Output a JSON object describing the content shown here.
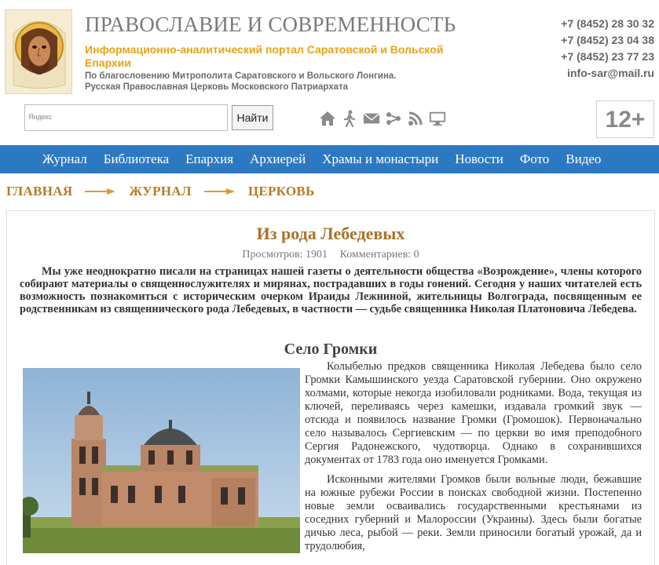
{
  "header": {
    "title": "ПРАВОСЛАВИЕ И СОВРЕМЕННОСТЬ",
    "subtitle": "Информационно-аналитический портал Саратовской и Вольской Епархии",
    "blessing_line1": "По благословению Митрополита Саратовского и Вольского Лонгина.",
    "blessing_line2": "Русская Православная Церковь Московского Патриархата",
    "phones": [
      "+7 (8452) 28 30 32",
      "+7 (8452) 23 04 38",
      "+7 (8452) 23 77 23"
    ],
    "email": "info-sar@mail.ru",
    "age_rating": "12+"
  },
  "search": {
    "provider_label": "Яндекс",
    "value": "",
    "placeholder": "",
    "button_label": "Найти"
  },
  "toolbar_icons": [
    "home-icon",
    "walking-person-icon",
    "mail-icon",
    "sitemap-icon",
    "rss-icon",
    "monitor-icon"
  ],
  "nav": {
    "items": [
      "Журнал",
      "Библиотека",
      "Епархия",
      "Архиерей",
      "Храмы и монастыри",
      "Новости",
      "Фото",
      "Видео"
    ]
  },
  "breadcrumb": {
    "items": [
      "ГЛАВНАЯ",
      "ЖУРНАЛ",
      "ЦЕРКОВЬ"
    ]
  },
  "article": {
    "title": "Из рода Лебедевых",
    "views": "Просмотров: 1901",
    "comments": "Комментариев: 0",
    "lead": "Мы уже неоднократно писали на страницах нашей газеты о деятельности общества «Возрождение», члены которого собирают материалы о священнослужителях и мирянах, пострадавших в годы гонений. Сегодня у наших читателей есть возможность познакомиться с историческим очерком Ираиды Лежниной, жительницы Волгограда, посвященным ее родственникам из священнического рода Лебедевых, в частности — судьбе священника Николая Платоновича Лебедева.",
    "section_title": "Село Громки",
    "paragraphs": [
      "Колыбелью предков священника Николая Лебедева было село Громки Камышинского уезда Саратовской губернии. Оно окружено холмами, которые некогда изобиловали родниками. Вода, текущая из ключей, переливаясь через камешки, издавала громкий звук — отсюда и появилось название Громки (Громошок). Первоначально село называлось Сергиевским — по церкви во имя преподобного Сергия Радонежского, чудотворца. Однако в сохранившихся документах от 1783 года оно именуется Громками.",
      "Исконными жителями Громков были вольные люди, бежавшие на южные рубежи России в поисках свободной жизни. Постепенно новые земли осваивались государственными крестьянами из соседних губерний и Малороссии (Украины). Здесь были богатые дичью леса, рыбой — реки. Земли приносили богатый урожай, да и трудолюбия,"
    ]
  },
  "colors": {
    "nav_bg": "#2c79c2",
    "accent_gold": "#e8a317",
    "breadcrumb": "#b87a24",
    "article_title": "#a8732a"
  }
}
